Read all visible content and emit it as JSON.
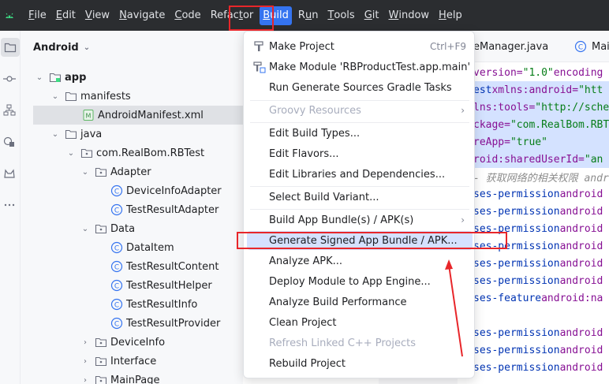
{
  "menubar": {
    "items": [
      {
        "pre": "",
        "u": "F",
        "post": "ile"
      },
      {
        "pre": "",
        "u": "E",
        "post": "dit"
      },
      {
        "pre": "",
        "u": "V",
        "post": "iew"
      },
      {
        "pre": "",
        "u": "N",
        "post": "avigate"
      },
      {
        "pre": "",
        "u": "C",
        "post": "ode"
      },
      {
        "pre": "Refac",
        "u": "t",
        "post": "or"
      },
      {
        "pre": "",
        "u": "B",
        "post": "uild"
      },
      {
        "pre": "R",
        "u": "u",
        "post": "n"
      },
      {
        "pre": "",
        "u": "T",
        "post": "ools"
      },
      {
        "pre": "",
        "u": "G",
        "post": "it"
      },
      {
        "pre": "",
        "u": "W",
        "post": "indow"
      },
      {
        "pre": "",
        "u": "H",
        "post": "elp"
      }
    ]
  },
  "project": {
    "header": "Android",
    "tree": [
      {
        "label": "app",
        "bold": true
      },
      {
        "label": "manifests"
      },
      {
        "label": "AndroidManifest.xml"
      },
      {
        "label": "java"
      },
      {
        "label": "com.RealBom.RBTest"
      },
      {
        "label": "Adapter"
      },
      {
        "label": "DeviceInfoAdapter"
      },
      {
        "label": "TestResultAdapter"
      },
      {
        "label": "Data"
      },
      {
        "label": "DataItem"
      },
      {
        "label": "TestResultContent"
      },
      {
        "label": "TestResultHelper"
      },
      {
        "label": "TestResultInfo"
      },
      {
        "label": "TestResultProvider"
      },
      {
        "label": "DeviceInfo"
      },
      {
        "label": "Interface"
      },
      {
        "label": "MainPage"
      }
    ]
  },
  "editor": {
    "tabs": [
      "eManager.java",
      "Main"
    ],
    "code": {
      "l0": {
        "a": "version=",
        "b": "\"1.0\"",
        "c": " encoding"
      },
      "l1": {
        "a": "est ",
        "b": "xmlns:android=",
        "c": "\"htt"
      },
      "l2": {
        "a": "lns:tools=",
        "b": "\"http://sche"
      },
      "l3": {
        "a": "ckage=",
        "b": "\"com.RealBom.RBT"
      },
      "l4": {
        "a": "reApp=",
        "b": "\"true\""
      },
      "l5": {
        "a": "roid:sharedUserId=",
        "b": "\"an"
      },
      "l6": {
        "a": "- 获取网络的相关权限 andr"
      },
      "l7": {
        "a": "ses-permission ",
        "b": "android"
      },
      "l8": {
        "a": "ses-permission ",
        "b": "android"
      },
      "l9": {
        "a": "ses-permission ",
        "b": "android"
      },
      "l10": {
        "a": "ses-permission ",
        "b": "android"
      },
      "l11": {
        "a": "ses-permission ",
        "b": "android"
      },
      "l12": {
        "a": "ses-permission ",
        "b": "android"
      },
      "l13": {
        "a": "ses-feature ",
        "b": "android:na"
      },
      "l14": {
        "a": "ses-permission ",
        "b": "android"
      },
      "l15": {
        "a": "ses-permission ",
        "b": "android"
      },
      "l16": {
        "a": "ses-permission ",
        "b": "android"
      }
    }
  },
  "build_menu": {
    "make_project": "Make Project",
    "make_project_shortcut": "Ctrl+F9",
    "make_module": "Make Module 'RBProductTest.app.main'",
    "run_generate": "Run Generate Sources Gradle Tasks",
    "groovy": "Groovy Resources",
    "edit_build_types": "Edit Build Types...",
    "edit_flavors": "Edit Flavors...",
    "edit_libraries": "Edit Libraries and Dependencies...",
    "select_variant": "Select Build Variant...",
    "build_bundle": "Build App Bundle(s) / APK(s)",
    "generate_signed": "Generate Signed App Bundle / APK...",
    "analyze_apk": "Analyze APK...",
    "deploy_module": "Deploy Module to App Engine...",
    "analyze_perf": "Analyze Build Performance",
    "clean_project": "Clean Project",
    "refresh_linked": "Refresh Linked C++ Projects",
    "rebuild_project": "Rebuild Project"
  },
  "colors": {
    "highlight": "#e8262a",
    "menubar_bg": "#2b2d30",
    "hover_bg": "#d5e1ff"
  }
}
